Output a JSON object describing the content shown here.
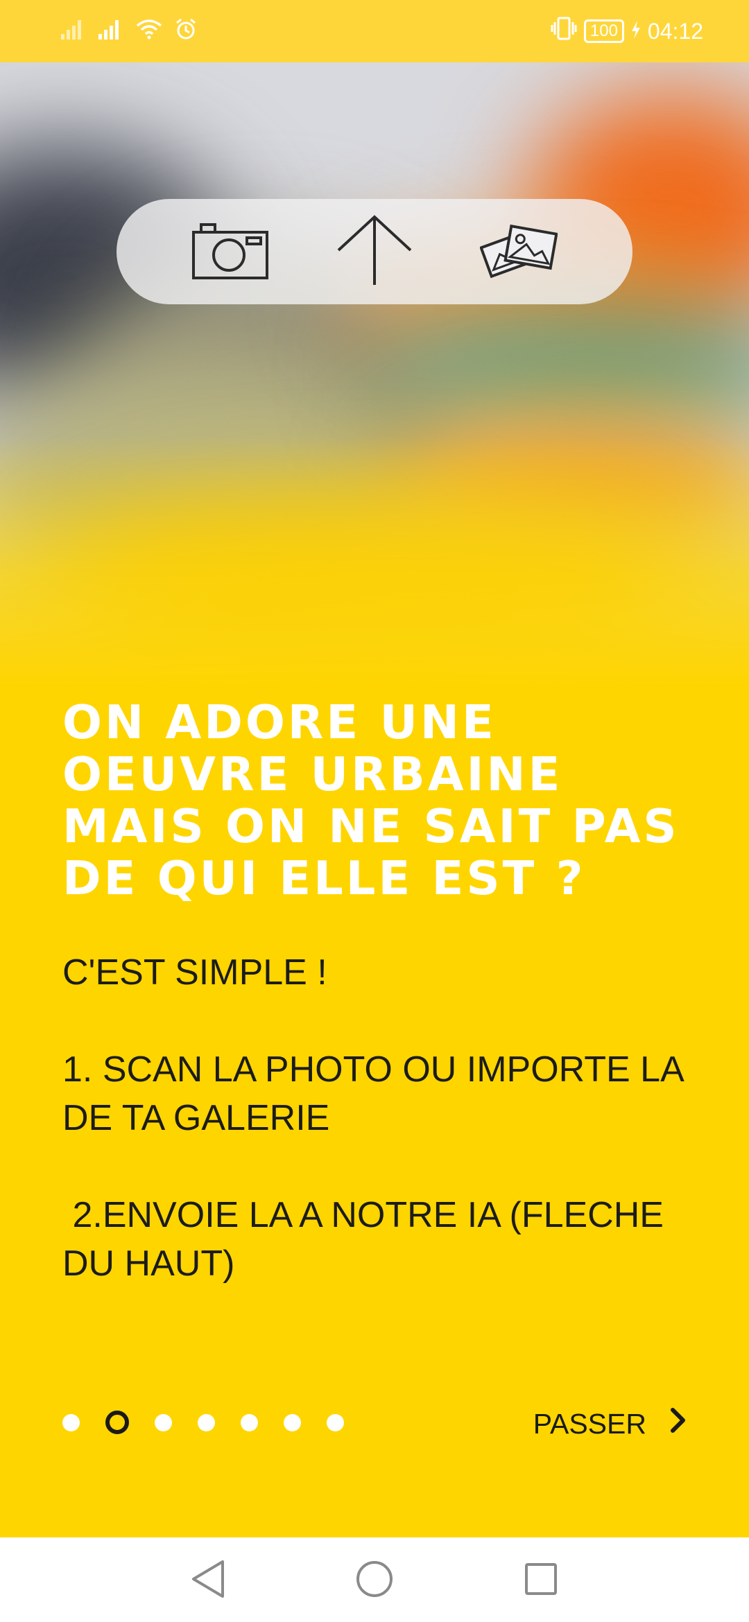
{
  "status_bar": {
    "battery": "100",
    "time": "04:12"
  },
  "toolbar": {
    "icons": [
      "camera-icon",
      "upload-arrow-icon",
      "gallery-icon"
    ]
  },
  "onboarding": {
    "headline": "ON ADORE UNE OEUVRE URBAINE MAIS ON NE SAIT PAS DE QUI ELLE EST ?",
    "body": "C'EST SIMPLE !\n\n1. SCAN LA PHOTO OU IMPORTE LA DE TA GALERIE\n\n 2.ENVOIE LA A NOTRE IA (FLECHE DU HAUT)",
    "page_count": 7,
    "current_page": 2,
    "skip_label": "PASSER"
  },
  "colors": {
    "background": "#FFD500",
    "status_bar": "#FFD63A",
    "text_dark": "#1C1C1C",
    "headline": "#FFFFFF"
  }
}
